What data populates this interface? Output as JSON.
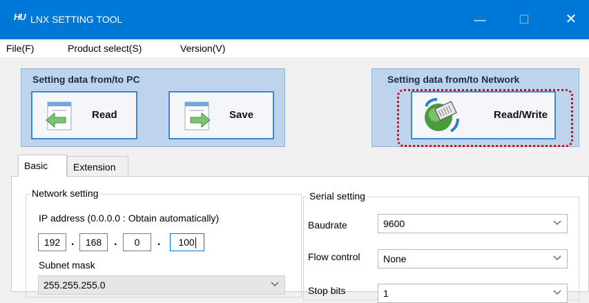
{
  "window": {
    "icon_text": "HU",
    "title": "LNX SETTING TOOL",
    "minimize": "—",
    "maximize": "☐",
    "close": "✕"
  },
  "menu": {
    "items": [
      "File(F)",
      "Product select(S)",
      "Version(V)"
    ]
  },
  "pc_panel": {
    "title": "Setting data from/to PC",
    "read_label": "Read",
    "save_label": "Save"
  },
  "network_panel": {
    "title": "Setting data from/to Network",
    "readwrite_label": "Read/Write"
  },
  "tabs": [
    {
      "label": "Basic",
      "active": true
    },
    {
      "label": "Extension",
      "active": false
    }
  ],
  "network_setting": {
    "title": "Network setting",
    "ip_label": "IP address (0.0.0.0 : Obtain automatically)",
    "ip": [
      "192",
      "168",
      "0",
      "100"
    ],
    "subnet_label": "Subnet mask",
    "subnet_value": "255.255.255.0"
  },
  "serial_setting": {
    "title": "Serial setting",
    "baudrate_label": "Baudrate",
    "baudrate_value": "9600",
    "flow_label": "Flow control",
    "flow_value": "None",
    "stop_label": "Stop bits",
    "stop_value": "1"
  },
  "colors": {
    "titlebar": "#0078d7",
    "panel": "#bdd4ec",
    "highlight": "#c8101e"
  }
}
